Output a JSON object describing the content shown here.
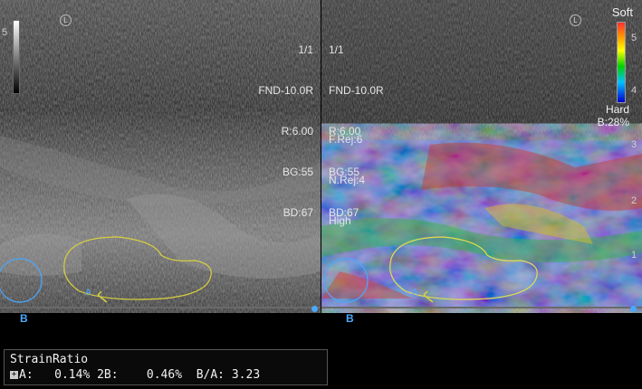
{
  "left_panel": {
    "mark": "L",
    "frame": "1/1",
    "probe": "FND-10.0R",
    "r": "R:6.00",
    "bg": "BG:55",
    "bd": "BD:67",
    "bottom_label": "B",
    "roi_label": "A"
  },
  "right_panel": {
    "mark": "L",
    "frame": "1/1",
    "probe": "FND-10.0R",
    "r": "R:6.00",
    "bg": "BG:55",
    "bd": "BD:67",
    "frej": "F.Rej:6",
    "nrej": "N.Rej:4",
    "quality": "High",
    "bottom_label": "B",
    "roi_label": "A",
    "colorbar": {
      "top": "Soft",
      "bottom": "Hard",
      "b_value": "B:28%",
      "ticks": [
        "5",
        "4"
      ]
    },
    "depth_ticks": [
      "3",
      "2",
      "1"
    ]
  },
  "left_ticks": [
    "5"
  ],
  "strain_ratio": {
    "title": "StrainRatio",
    "a_label": "A:",
    "a_value": "0.14%",
    "b_label": "2B:",
    "b_value": "0.46%",
    "ratio_label": "B/A:",
    "ratio_value": "3.23"
  },
  "colors": {
    "roi_outline": "#d8d040",
    "circle_roi": "#4aa9ff",
    "background": "#000000"
  }
}
